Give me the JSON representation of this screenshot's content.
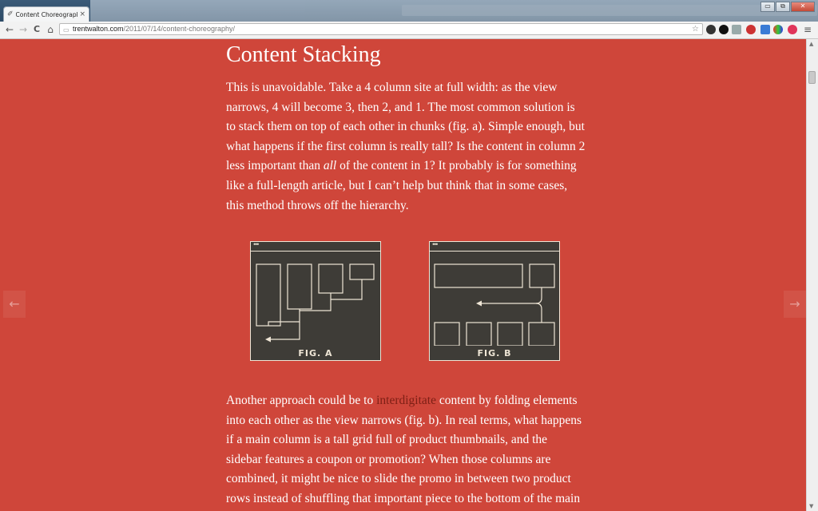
{
  "browser": {
    "tab_title": "Content Choreography | T",
    "tab_favicon": "tw-logo-icon",
    "close_glyph": "×",
    "url_domain": "trentwalton.com",
    "url_path": "/2011/07/14/content-choreography/",
    "back_glyph": "←",
    "forward_glyph": "→",
    "reload_glyph": "C",
    "home_glyph": "⌂",
    "star_glyph": "☆",
    "menu_glyph": "≡",
    "page_icon_glyph": "▭",
    "minimize_glyph": "▭",
    "maximize_glyph": "⧉",
    "window_close_glyph": "✕"
  },
  "article": {
    "heading": "Content Stacking",
    "p1_a": "This is unavoidable. Take a 4 column site at full width: as the view narrows, 4 will become 3, then 2, and 1. The most common solution is to stack them on top of each other in chunks (fig. a). Simple enough, but what happens if the first column is really tall? Is the content in column 2 less important than ",
    "p1_em": "all",
    "p1_b": " of the content in 1? It probably is for something like a full-length article, but I can’t help but think that in some cases, this method throws off the hierarchy.",
    "p2_a": "Another approach could be to ",
    "p2_link": "interdigitate",
    "p2_b": " content by folding elements into each other as the view narrows (fig. b). In real terms, what happens if a main column is a tall grid full of product thumbnails, and the sidebar features a coupon or promotion? When those columns are combined, it might be nice to slide the promo in between two product rows instead of shuffling that important piece to the bottom of the main column."
  },
  "figures": {
    "a_caption": "FIG. A",
    "b_caption": "FIG. B",
    "dots": "•••"
  },
  "nav": {
    "prev_glyph": "←",
    "next_glyph": "→"
  },
  "colors": {
    "page_background": "#cf463a",
    "figure_background": "#3e3c37",
    "figure_line": "#efe6d6",
    "link": "#7d1f15"
  }
}
